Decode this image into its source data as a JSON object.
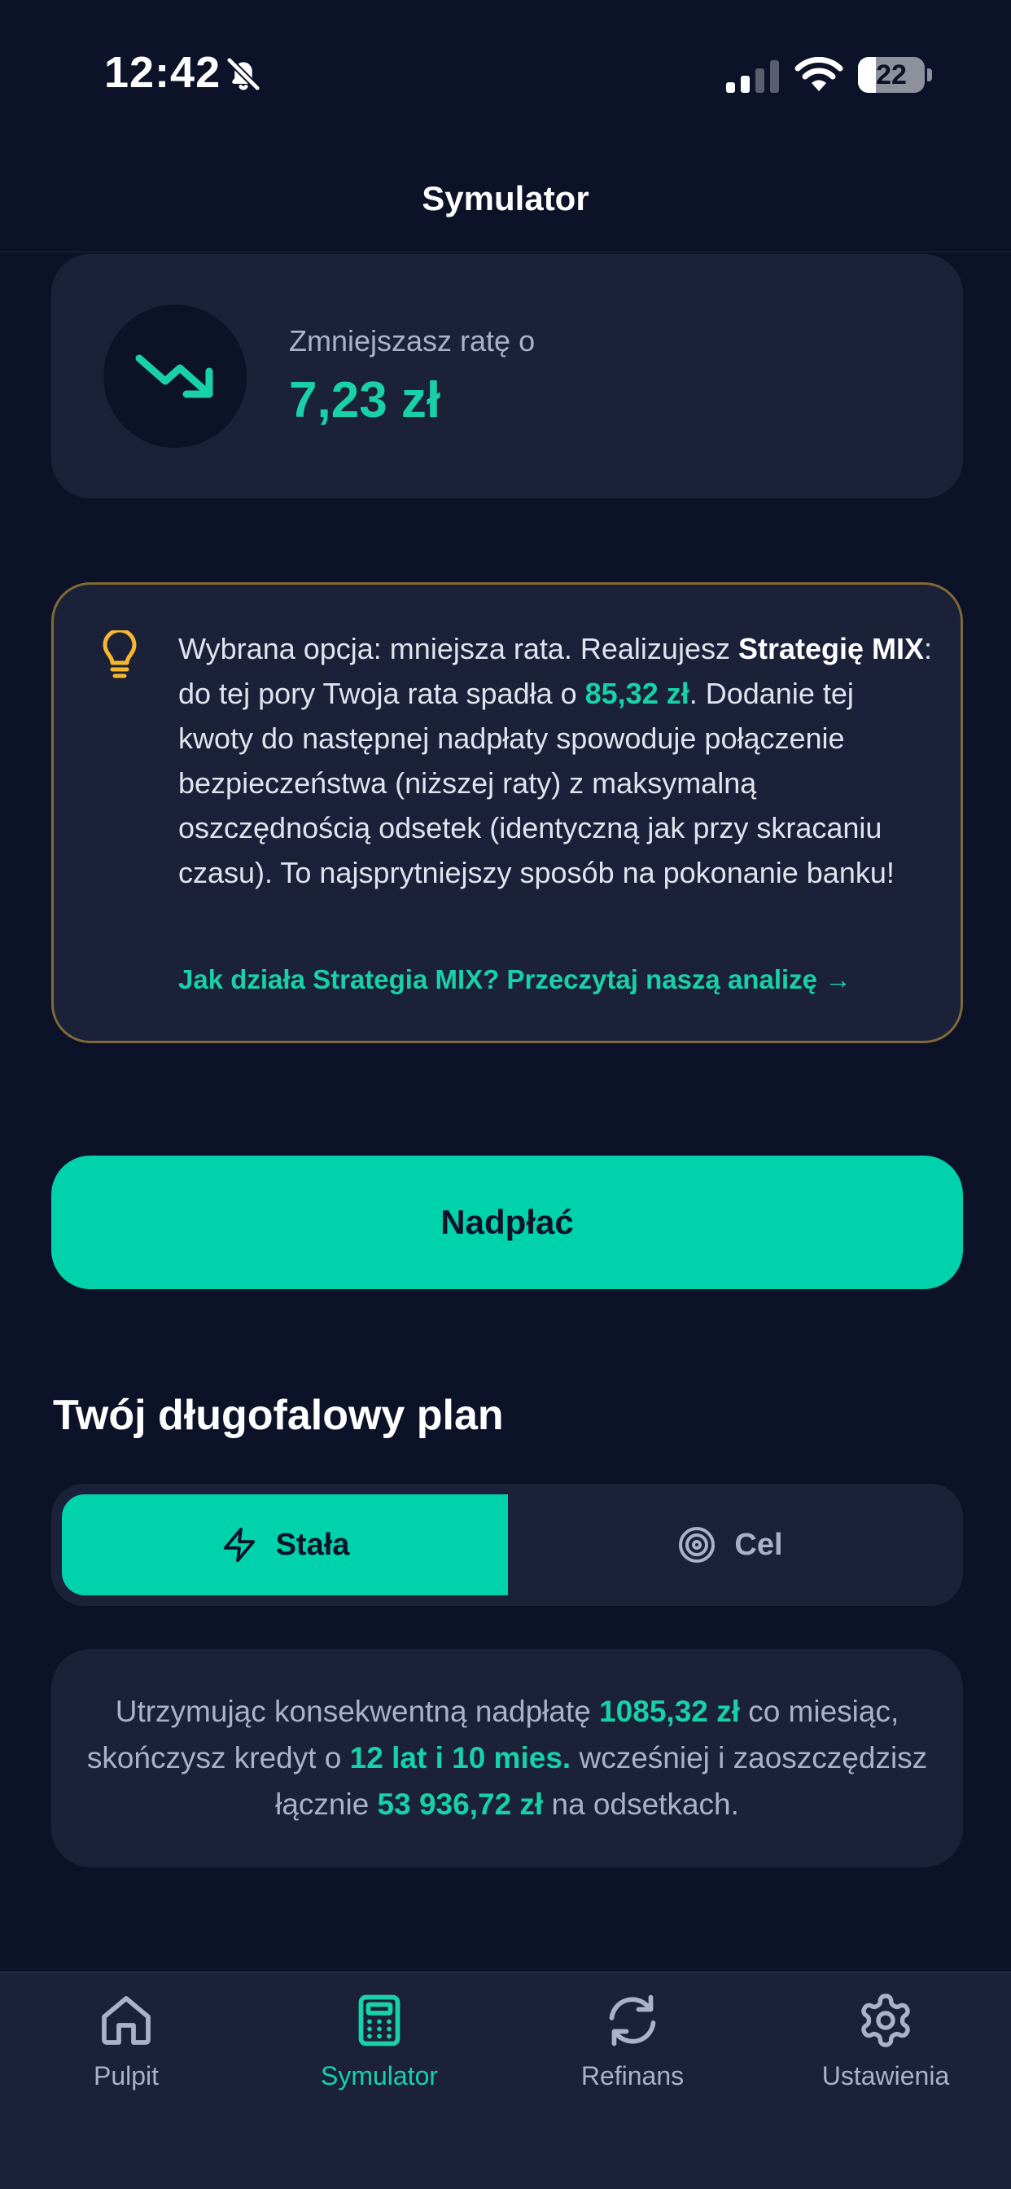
{
  "status_bar": {
    "time": "12:42",
    "battery": "22"
  },
  "header": {
    "title": "Symulator"
  },
  "savings": {
    "label": "Zmniejszasz ratę o",
    "value": "7,23 zł"
  },
  "info": {
    "text_1": "Wybrana opcja: mniejsza rata. Realizujesz ",
    "text_bold": "Strategię MIX",
    "text_2": ": do tej pory Twoja rata spadła o ",
    "text_amount": "85,32 zł",
    "text_3": ". Dodanie tej kwoty do następnej nadpłaty spowoduje połączenie bezpieczeństwa (niższej raty) z maksymalną oszczędnością odsetek (identyczną jak przy skracaniu czasu). To najsprytniejszy sposób na pokonanie banku!",
    "link": "Jak działa Strategia MIX? Przeczytaj naszą analizę →"
  },
  "overpay_button": "Nadpłać",
  "plan": {
    "heading": "Twój długofalowy plan",
    "tabs": [
      {
        "label": "Stała",
        "active": true
      },
      {
        "label": "Cel",
        "active": false
      }
    ],
    "summary": {
      "part_1": "Utrzymując konsekwentną nadpłatę ",
      "amount": "1085,32 zł",
      "part_2": " co miesiąc, skończysz kredyt o ",
      "duration": "12 lat i 10 mies.",
      "part_3": " wcześniej i zaoszczędzisz łącznie ",
      "savings": "53 936,72 zł",
      "part_4": " na odsetkach."
    }
  },
  "tab_bar": {
    "items": [
      {
        "label": "Pulpit",
        "icon": "home-icon",
        "active": false
      },
      {
        "label": "Symulator",
        "icon": "calculator-icon",
        "active": true
      },
      {
        "label": "Refinans",
        "icon": "refresh-icon",
        "active": false
      },
      {
        "label": "Ustawienia",
        "icon": "gear-icon",
        "active": false
      }
    ]
  },
  "colors": {
    "background": "#0c1227",
    "card": "#1b2139",
    "accent": "#00d2ab",
    "warning_border": "#7f6a35",
    "bulb": "#f5b82e"
  }
}
